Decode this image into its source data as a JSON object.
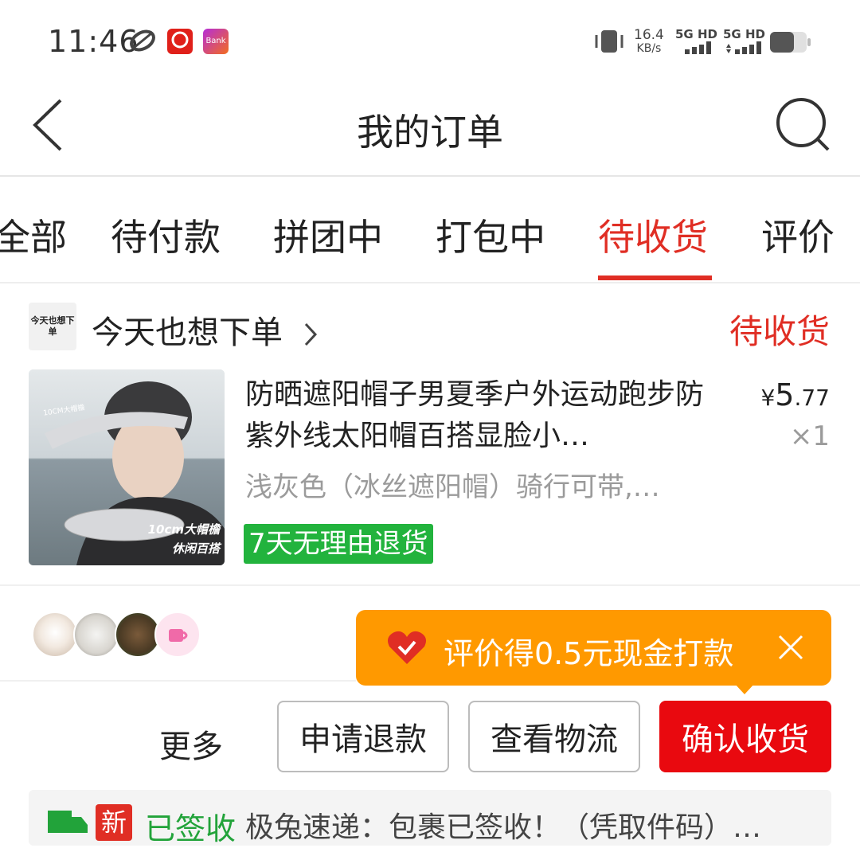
{
  "status_bar": {
    "time": "11:46",
    "net_speed_value": "16.4",
    "net_speed_unit": "KB/s",
    "sim1": "5G HD",
    "sim2": "5G HD",
    "app_icon_2_text": "Bank"
  },
  "header": {
    "title": "我的订单"
  },
  "tabs": [
    {
      "label": "全部"
    },
    {
      "label": "待付款"
    },
    {
      "label": "拼团中"
    },
    {
      "label": "打包中"
    },
    {
      "label": "待收货",
      "active": true
    },
    {
      "label": "评价"
    }
  ],
  "order": {
    "store_logo_text": "今天也想下单",
    "store_name": "今天也想下单",
    "status": "待收货",
    "product": {
      "title": "防晒遮阳帽子男夏季户外运动跑步防紫外线太阳帽百搭显脸小…",
      "currency": "¥",
      "price_int": "5",
      "price_dec": ".77",
      "quantity": "×1",
      "spec": "浅灰色（冰丝遮阳帽）骑行可带,…",
      "return_badge": "7天无理由退货",
      "image_caption_1": "10cm大帽檐",
      "image_caption_2": "休闲百搭",
      "image_tag": "10CM大帽檐"
    }
  },
  "review_tip": {
    "text": "评价得0.5元现金打款"
  },
  "actions": {
    "more": "更多",
    "refund": "申请退款",
    "logistics": "查看物流",
    "confirm": "确认收货"
  },
  "logistics": {
    "new_badge": "新",
    "signed": "已签收",
    "detail": "极兔速递：包裹已签收！（凭取件码）…"
  },
  "colors": {
    "accent_red": "#e02e24",
    "confirm_red": "#e9090f",
    "tip_orange": "#ff9900",
    "return_green": "#22b33d"
  }
}
